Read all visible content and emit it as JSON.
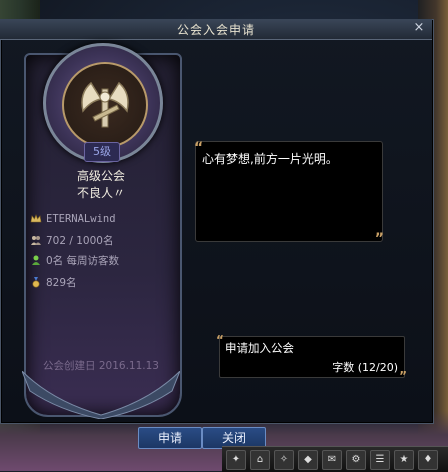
{
  "window": {
    "title": "公会入会申请",
    "close_label": "×"
  },
  "guild": {
    "level": "5级",
    "rank": "高级公会",
    "name": "不良人〃",
    "master": "ETERNALwind",
    "members": "702 / 1000名",
    "weekly_visitors": "0名 每周访客数",
    "points": "829名",
    "founded": "公会创建日 2016.11.13",
    "crest_icon": "axe-crest-icon"
  },
  "bubble": {
    "message": "心有梦想,前方一片光明。"
  },
  "apply": {
    "text": "申请加入公会",
    "char_count": "字数 (12/20)"
  },
  "buttons": {
    "apply_label": "申请",
    "close_label": "关闭"
  },
  "colors": {
    "button_bg": "#2a4c85",
    "quote_gold": "#c9a066",
    "level_text": "#9aa6e8"
  }
}
